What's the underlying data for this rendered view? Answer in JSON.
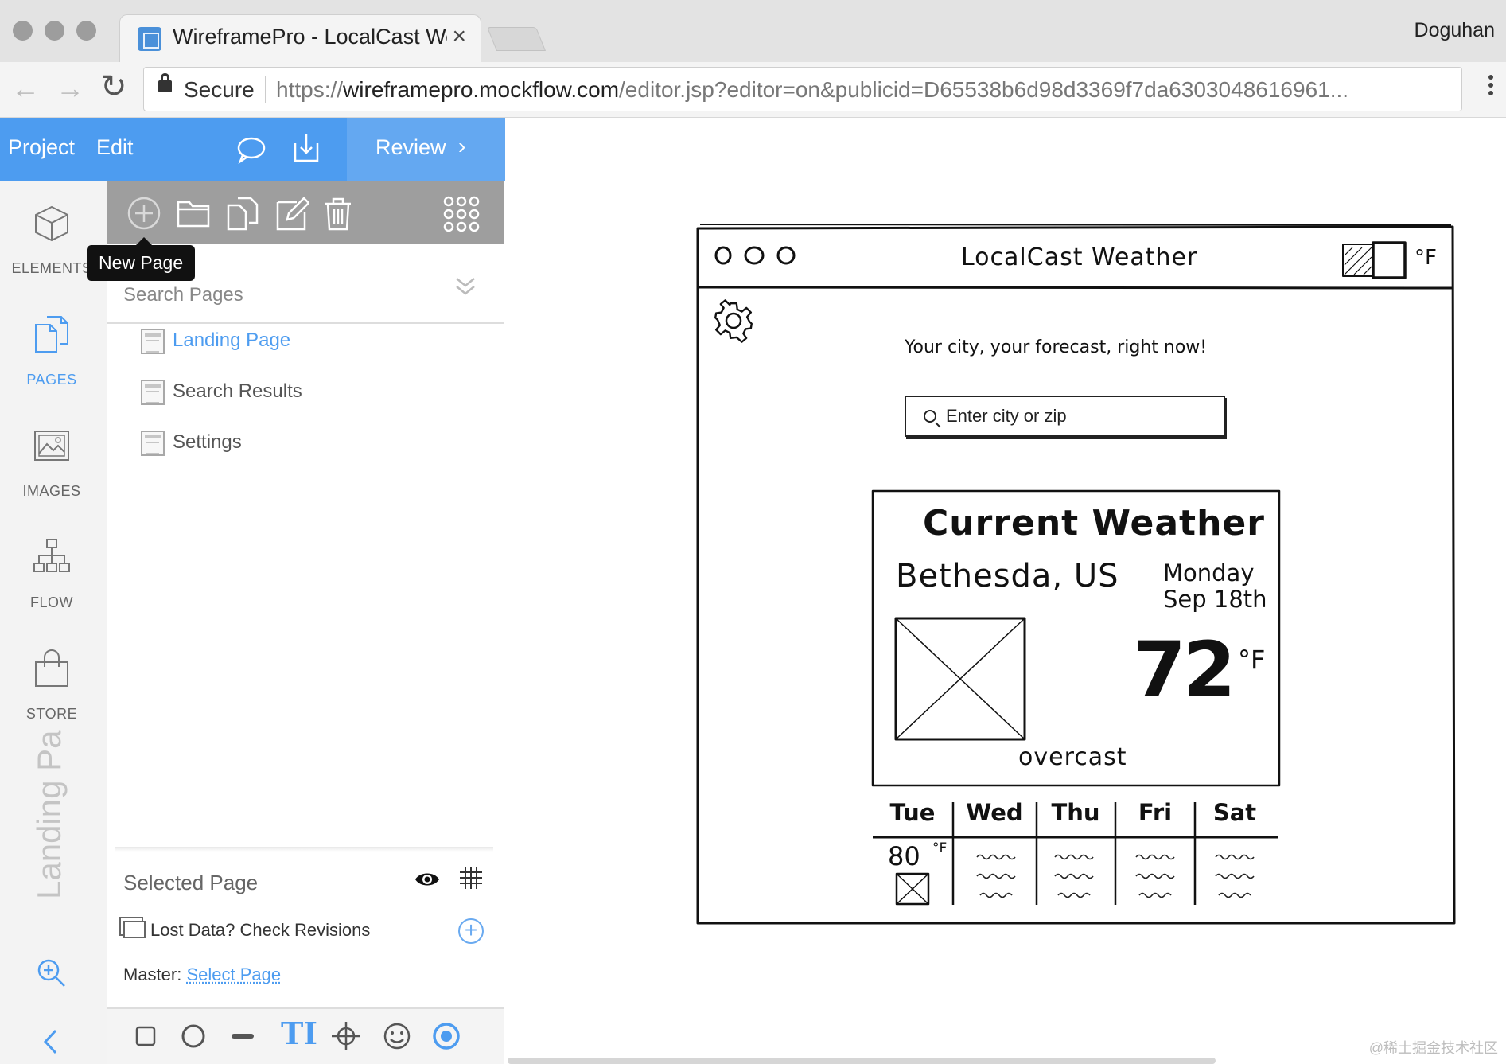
{
  "browser": {
    "tab_title": "WireframePro - LocalCast Weather",
    "tab_close": "×",
    "profile_name": "Doguhan",
    "secure_label": "Secure",
    "url_scheme": "https://",
    "url_host": "wireframepro.mockflow.com",
    "url_path": "/editor.jsp?editor=on&publicid=D65538b6d98d3369f7da6303048616961...",
    "back_icon": "←",
    "forward_icon": "→",
    "reload_icon": "↻"
  },
  "editor": {
    "menu_project": "Project",
    "menu_edit": "Edit",
    "review_label": "Review",
    "review_chevron": "›",
    "rail": {
      "elements": "ELEMENTS",
      "pages": "PAGES",
      "images": "IMAGES",
      "flow": "FLOW",
      "store": "STORE",
      "vertical_label": "Landing Pa"
    },
    "tooltip": "New Page",
    "search_placeholder": "Search Pages",
    "pages": [
      {
        "name": "Landing Page",
        "current": true
      },
      {
        "name": "Search Results",
        "current": false
      },
      {
        "name": "Settings",
        "current": false
      }
    ],
    "selected_page_title": "Selected Page",
    "revisions_label": "Lost Data? Check Revisions",
    "revisions_add": "+",
    "master_label": "Master:",
    "master_link": "Select Page",
    "icons": [
      "comment-icon",
      "download-icon",
      "add-page-icon",
      "folder-icon",
      "duplicate-icon",
      "edit-icon",
      "delete-icon",
      "grid-menu-icon",
      "collapse-icon",
      "eye-icon",
      "grid-icon",
      "zoom-in-icon",
      "chevron-left-icon",
      "rectangle-tool-icon",
      "circle-tool-icon",
      "line-tool-icon",
      "text-tool-icon",
      "move-tool-icon",
      "emoji-tool-icon",
      "target-tool-icon"
    ],
    "accent_color": "#4d9cf0",
    "text_tool_label": "TI"
  },
  "mockup": {
    "app_title": "LocalCast Weather",
    "unit_toggle": "°F",
    "tagline": "Your city, your forecast, right now!",
    "search_placeholder": "Enter city or zip",
    "current_title": "Current Weather",
    "city": "Bethesda, US",
    "day": "Monday",
    "date": "Sep 18th",
    "temperature": "72",
    "temp_unit": "°F",
    "condition": "overcast",
    "forecast_days": [
      "Tue",
      "Wed",
      "Thu",
      "Fri",
      "Sat"
    ],
    "forecast_first_temp": "80",
    "forecast_first_unit": "°F"
  },
  "watermark": "@稀土掘金技术社区"
}
